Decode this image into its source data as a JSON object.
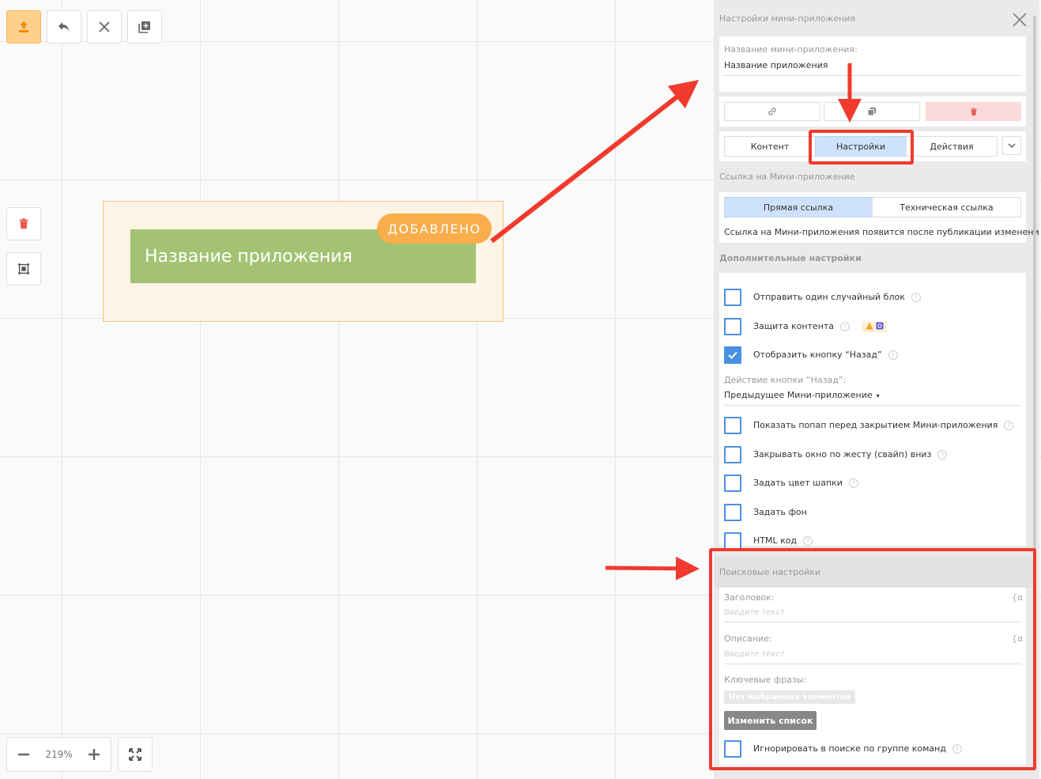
{
  "canvas": {
    "block_title": "Название приложения",
    "badge": "ДОБАВЛЕНО",
    "zoom_level": "219%"
  },
  "panel": {
    "header": "Настройки мини-приложения",
    "name_label": "Название мини-приложения:",
    "name_value": "Название приложения",
    "tabs": [
      "Контент",
      "Настройки",
      "Действия"
    ],
    "active_tab": "Настройки",
    "link_section": {
      "title": "Ссылка на Мини-приложение",
      "options": [
        "Прямая ссылка",
        "Техническая ссылка"
      ],
      "selected": "Прямая ссылка",
      "note": "Ссылка на Мини-приложения появится после публикации изменений."
    },
    "extra_section": {
      "title": "Дополнительные настройки",
      "items": [
        {
          "label": "Отправить один случайный блок",
          "checked": false
        },
        {
          "label": "Защита контента",
          "checked": false
        },
        {
          "label": "Отобразить кнопку “Назад”",
          "checked": true
        }
      ],
      "back_action_label": "Действие кнопки “Назад”:",
      "back_action_value": "Предыдущее Мини-приложение",
      "more_items": [
        {
          "label": "Показать попап перед закрытием Мини-приложения",
          "checked": false
        },
        {
          "label": "Закрывать окно по жесту (свайп) вниз",
          "checked": false
        },
        {
          "label": "Задать цвет шапки",
          "checked": false
        },
        {
          "label": "Задать фон",
          "checked": false
        },
        {
          "label": "HTML код",
          "checked": false
        }
      ]
    },
    "search_section": {
      "title": "Поисковые настройки",
      "heading_label": "Заголовок:",
      "heading_placeholder": "Введите текст",
      "desc_label": "Описание:",
      "desc_placeholder": "Введите текст",
      "keyphrases_label": "Ключевые фразы:",
      "no_items": "Нет выбранных элементов",
      "change_list": "Изменить список",
      "ignore_label": "Игнорировать в поиске по группе команд",
      "ignore_checked": false,
      "var_icon": "{α"
    }
  },
  "colors": {
    "accent_orange": "#f9ad4b",
    "block_green": "#a3c373",
    "checkbox_blue": "#4a90e2",
    "annotation_red": "#f03a2e",
    "active_tab_bg": "#cfe2fb"
  }
}
